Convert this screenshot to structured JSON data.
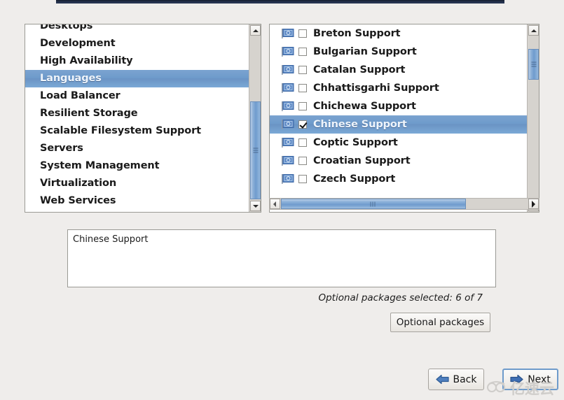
{
  "window": {
    "background_color": "#efedeb",
    "titlebar_color": "#26334f"
  },
  "group_list": {
    "name": "package-group-list",
    "selected": "Languages",
    "items": [
      {
        "label": "Desktops",
        "selected": false,
        "clipped": true
      },
      {
        "label": "Development",
        "selected": false
      },
      {
        "label": "High Availability",
        "selected": false
      },
      {
        "label": "Languages",
        "selected": true
      },
      {
        "label": "Load Balancer",
        "selected": false
      },
      {
        "label": "Resilient Storage",
        "selected": false
      },
      {
        "label": "Scalable Filesystem Support",
        "selected": false
      },
      {
        "label": "Servers",
        "selected": false
      },
      {
        "label": "System Management",
        "selected": false
      },
      {
        "label": "Virtualization",
        "selected": false
      },
      {
        "label": "Web Services",
        "selected": false
      }
    ]
  },
  "package_list": {
    "name": "optional-package-list",
    "selected": "Chinese Support",
    "icon": "flag-icon",
    "items": [
      {
        "label": "Breton Support",
        "checked": false,
        "selected": false
      },
      {
        "label": "Bulgarian Support",
        "checked": false,
        "selected": false
      },
      {
        "label": "Catalan Support",
        "checked": false,
        "selected": false
      },
      {
        "label": "Chhattisgarhi Support",
        "checked": false,
        "selected": false
      },
      {
        "label": "Chichewa Support",
        "checked": false,
        "selected": false
      },
      {
        "label": "Chinese Support",
        "checked": true,
        "selected": true
      },
      {
        "label": "Coptic Support",
        "checked": false,
        "selected": false
      },
      {
        "label": "Croatian Support",
        "checked": false,
        "selected": false
      },
      {
        "label": "Czech Support",
        "checked": false,
        "selected": false
      }
    ]
  },
  "description": {
    "text": "Chinese Support"
  },
  "status": {
    "text": "Optional packages selected: 6 of 7",
    "selected_count": 6,
    "total_count": 7
  },
  "buttons": {
    "optional_packages": "Optional packages",
    "back": "Back",
    "next": "Next"
  },
  "scrollbars": {
    "group_vertical": {
      "up_icon": "chevron-up-icon",
      "down_icon": "chevron-down-icon"
    },
    "package_vertical": {
      "up_icon": "chevron-up-icon",
      "down_icon": "chevron-down-icon"
    },
    "package_horizontal": {
      "left_icon": "chevron-left-icon",
      "right_icon": "chevron-right-icon"
    }
  },
  "watermark": {
    "text": "亿速云",
    "logo": "cloud-logo-icon",
    "color": "#cfcdca"
  },
  "colors": {
    "selection": "#6e9bcb",
    "selection_text": "#eef4fb",
    "panel_background": "#ffffff",
    "scrollbar_thumb": "#8fb2d9"
  }
}
